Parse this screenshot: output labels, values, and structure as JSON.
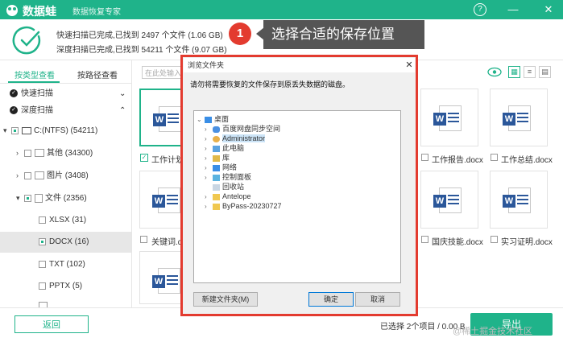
{
  "app": {
    "name": "数据蛙",
    "slogan": "数据恢复专家",
    "controls": {
      "help": "?",
      "minimize": "—",
      "close": "✕"
    },
    "accent": "#1fb38a"
  },
  "status": {
    "quick_scan": "快速扫描已完成,已找到 2497 个文件 (1.06 GB)",
    "deep_scan": "深度扫描已完成,已找到 54211 个文件 (9.07 GB)"
  },
  "callout": {
    "step": "1",
    "text": "选择合适的保存位置"
  },
  "left_panel": {
    "tabs": [
      "按类型查看",
      "按路径查看"
    ],
    "sections": [
      "快速扫描",
      "深度扫描"
    ],
    "tree": [
      {
        "label": "C:(NTFS) (54211)"
      },
      {
        "label": "其他 (34300)"
      },
      {
        "label": "图片 (3408)"
      },
      {
        "label": "文件 (2356)"
      },
      {
        "label": "XLSX (31)"
      },
      {
        "label": "DOCX (16)"
      },
      {
        "label": "TXT (102)"
      },
      {
        "label": "PPTX (5)"
      }
    ]
  },
  "content": {
    "search_placeholder": "在此处输入",
    "files": [
      {
        "name": "工作计划.d"
      },
      {
        "name": "工作报告.docx"
      },
      {
        "name": "工作总结.docx"
      },
      {
        "name": "关键词.d"
      },
      {
        "name": "国庆技能.docx"
      },
      {
        "name": "实习证明.docx"
      }
    ]
  },
  "footer": {
    "back": "返回",
    "export": "导出",
    "selected": "已选择 2个项目 / 0.00 B",
    "watermark": "@稀土掘金技术社区"
  },
  "dialog": {
    "title": "浏览文件夹",
    "close": "✕",
    "desc": "请勿将需要恢复的文件保存到原丢失数据的磁盘。",
    "tree": [
      {
        "label": "桌面"
      },
      {
        "label": "百度网盘同步空间"
      },
      {
        "label": "Administrator"
      },
      {
        "label": "此电脑"
      },
      {
        "label": "库"
      },
      {
        "label": "网络"
      },
      {
        "label": "控制面板"
      },
      {
        "label": "回收站"
      },
      {
        "label": "Antelope"
      },
      {
        "label": "ByPass-20230727"
      }
    ],
    "new_folder": "新建文件夹(M)",
    "ok": "确定",
    "cancel": "取消"
  }
}
